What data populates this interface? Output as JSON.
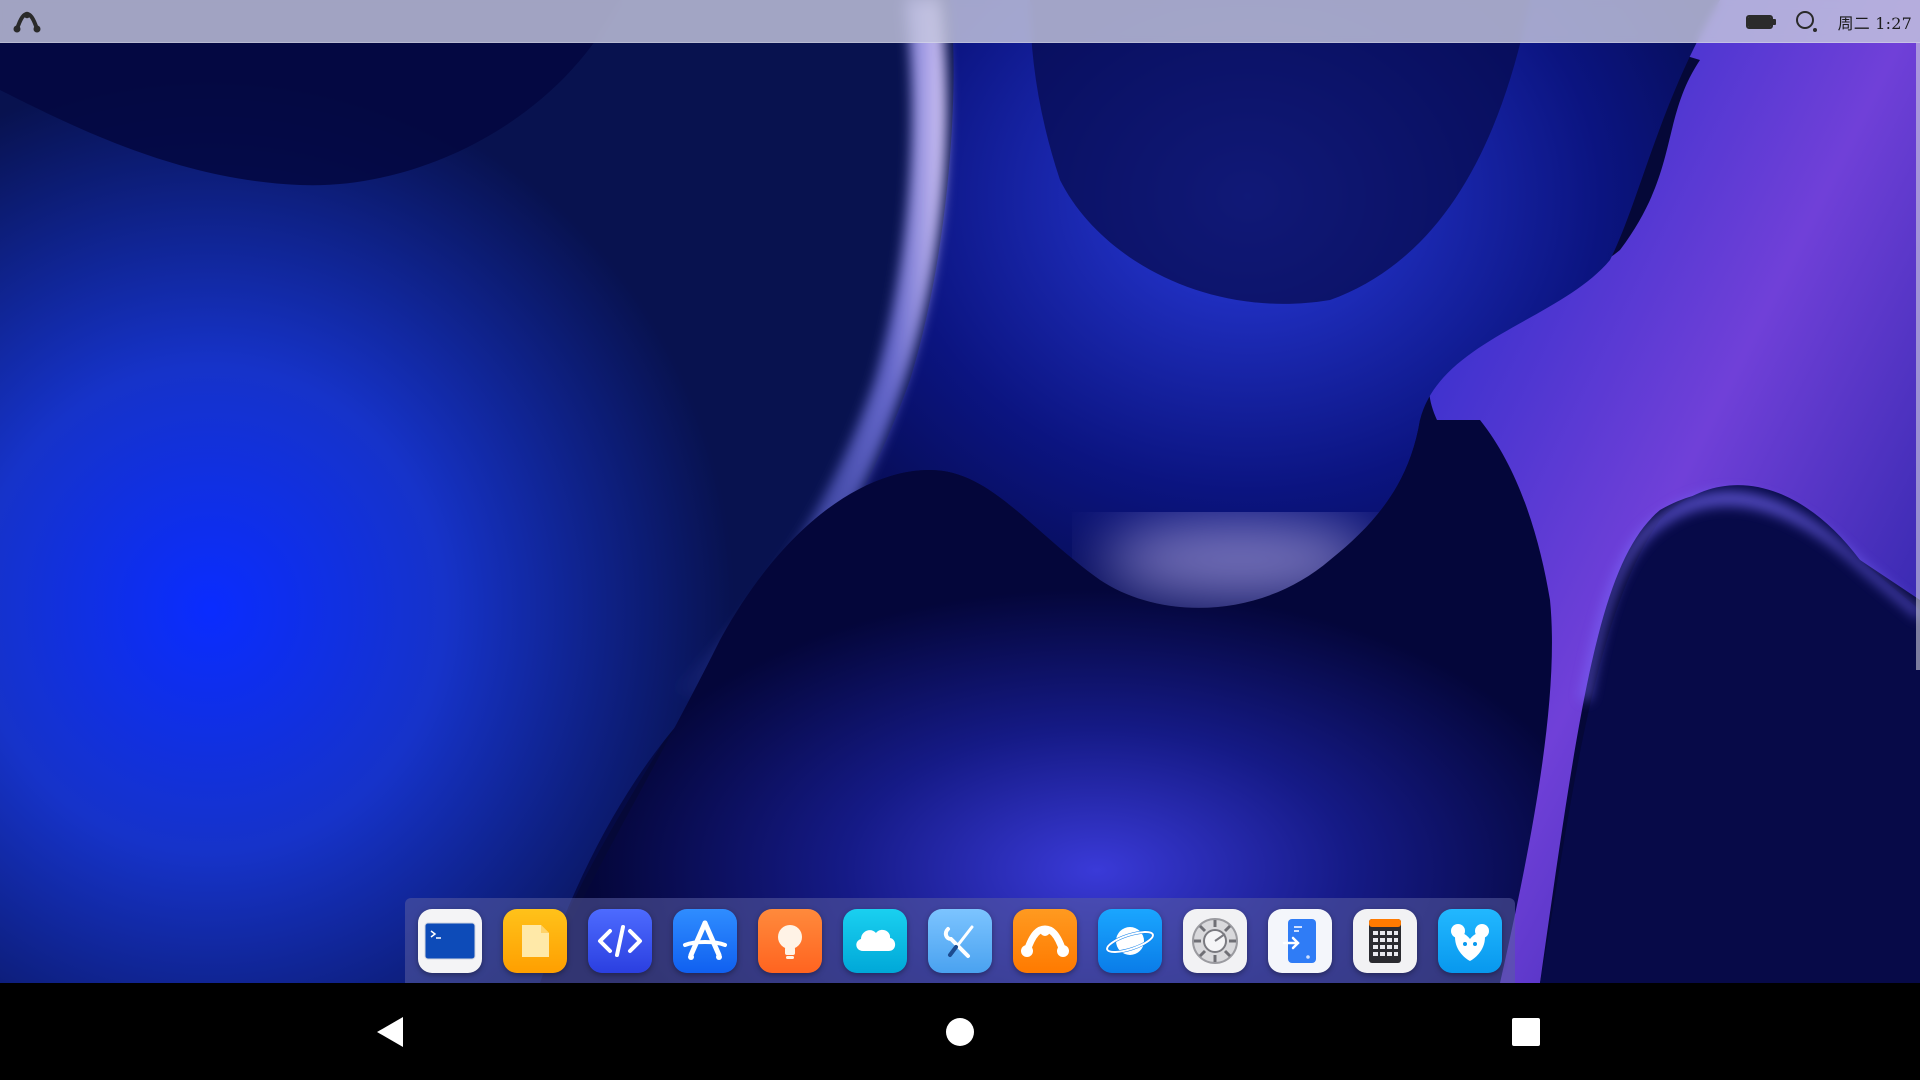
{
  "topbar": {
    "launcher_icon": "openkylin-logo-icon",
    "battery_icon": "battery-icon",
    "battery_level": 1.0,
    "search_icon": "search-icon",
    "clock": "周二 1:27"
  },
  "dock": {
    "items": [
      {
        "name": "terminal",
        "icon": "terminal-icon"
      },
      {
        "name": "files",
        "icon": "folder-icon"
      },
      {
        "name": "code-editor",
        "icon": "code-icon"
      },
      {
        "name": "app-store",
        "icon": "app-store-icon"
      },
      {
        "name": "tips",
        "icon": "lightbulb-icon"
      },
      {
        "name": "cloud",
        "icon": "cloud-icon"
      },
      {
        "name": "toolbox",
        "icon": "tools-icon"
      },
      {
        "name": "kylin",
        "icon": "kylin-logo-icon"
      },
      {
        "name": "browser",
        "icon": "planet-icon"
      },
      {
        "name": "settings",
        "icon": "gear-icon"
      },
      {
        "name": "device-manager",
        "icon": "phone-transfer-icon"
      },
      {
        "name": "calculator",
        "icon": "calculator-icon"
      },
      {
        "name": "assistant",
        "icon": "heart-mascot-icon"
      }
    ]
  },
  "navbar": {
    "back_icon": "back-triangle-icon",
    "home_icon": "home-circle-icon",
    "recents_icon": "recents-square-icon"
  },
  "colors": {
    "wallpaper_dark": "#03063a",
    "wallpaper_blue": "#1230e8",
    "wallpaper_highlight": "#b9a8ff",
    "topbar": "#c4c6de",
    "dock": "#5a5ca0"
  }
}
